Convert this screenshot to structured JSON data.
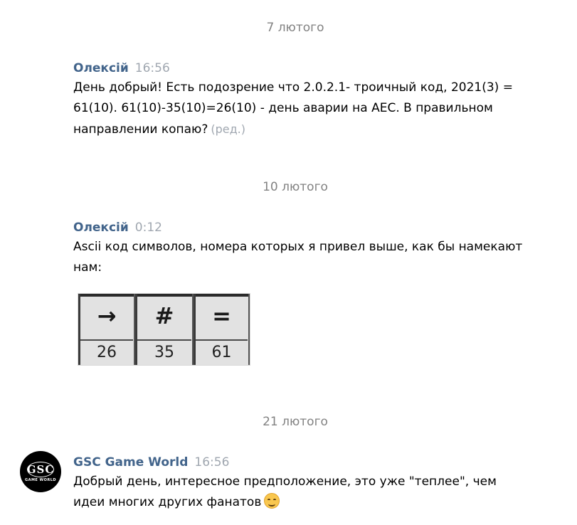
{
  "dates": {
    "first": "7 лютого",
    "second": "10 лютого",
    "third": "21 лютого"
  },
  "messages": [
    {
      "author": "Олексій",
      "time": "16:56",
      "text": "День добрый! Есть подозрение что 2.0.2.1- троичный код, 2021(3) = 61(10). 61(10)-35(10)=26(10) - день аварии на АЕС. В правильном направлении копаю?",
      "edited": "(ред.)"
    },
    {
      "author": "Олексій",
      "time": "0:12",
      "text": "Ascii код символов, номера которых я привел выше, как бы намекают нам:"
    },
    {
      "author": "GSC Game World",
      "time": "16:56",
      "text": "Добрый день, интересное предположение, это уже \"теплее\", чем идеи многих других фанатов",
      "emoji": "smiling-face-icon"
    }
  ],
  "ascii_image": {
    "cells": [
      {
        "symbol": "→",
        "code": "26"
      },
      {
        "symbol": "#",
        "code": "35"
      },
      {
        "symbol": "=",
        "code": "61"
      }
    ]
  },
  "avatar": {
    "logo": "GSC",
    "subtitle": "GAME WORLD",
    "background": "#000000"
  },
  "colors": {
    "author": "#42648b",
    "time": "#a0a7b0",
    "date": "#828282"
  }
}
